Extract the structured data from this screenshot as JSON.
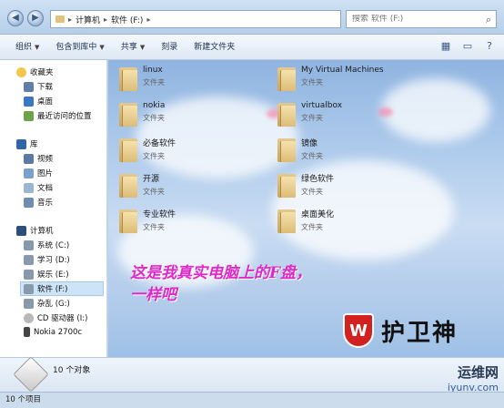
{
  "address": {
    "segments": [
      "计算机",
      "软件 (F:)"
    ],
    "search_placeholder": "搜索 软件 (F:)"
  },
  "toolbar": {
    "organize": "组织",
    "include_library": "包含到库中",
    "share": "共享",
    "burn": "刻录",
    "new_folder": "新建文件夹"
  },
  "sidebar": {
    "favorites": "收藏夹",
    "downloads": "下载",
    "desktop": "桌面",
    "recent": "最近访问的位置",
    "library": "库",
    "videos": "视频",
    "pictures": "图片",
    "documents": "文档",
    "music": "音乐",
    "computer": "计算机",
    "drives": [
      {
        "label": "系统 (C:)"
      },
      {
        "label": "学习 (D:)"
      },
      {
        "label": "娱乐 (E:)"
      },
      {
        "label": "软件 (F:)"
      },
      {
        "label": "杂乱 (G:)"
      },
      {
        "label": "CD 驱动器 (I:)"
      },
      {
        "label": "Nokia 2700c"
      }
    ]
  },
  "folders": [
    {
      "name": "linux",
      "type": "文件夹"
    },
    {
      "name": "My Virtual Machines",
      "type": "文件夹"
    },
    {
      "name": "nokia",
      "type": "文件夹"
    },
    {
      "name": "virtualbox",
      "type": "文件夹"
    },
    {
      "name": "必备软件",
      "type": "文件夹"
    },
    {
      "name": "镜像",
      "type": "文件夹"
    },
    {
      "name": "开源",
      "type": "文件夹"
    },
    {
      "name": "绿色软件",
      "type": "文件夹"
    },
    {
      "name": "专业软件",
      "type": "文件夹"
    },
    {
      "name": "桌面美化",
      "type": "文件夹"
    }
  ],
  "caption_line1": "这是我真实电脑上的F盘，",
  "caption_line2": "一样吧",
  "logo_text": "护卫神",
  "details": {
    "count": "10 个对象"
  },
  "status": {
    "text": "10 个项目"
  },
  "watermark": {
    "line1": "运维网",
    "line2": "iyunv.com"
  }
}
